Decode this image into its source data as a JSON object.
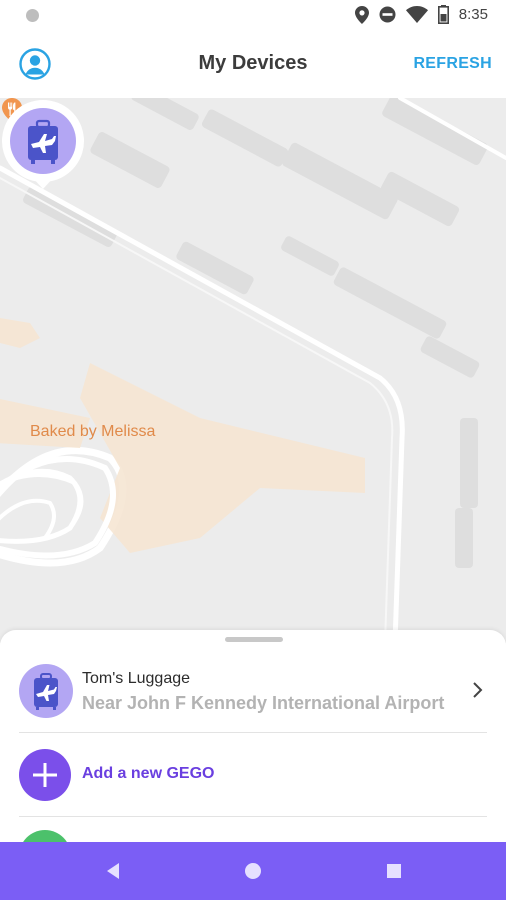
{
  "status_bar": {
    "time": "8:35",
    "icons": [
      "location-icon",
      "do-not-disturb-icon",
      "wifi-icon",
      "battery-icon"
    ]
  },
  "app_bar": {
    "title": "My Devices",
    "refresh_label": "REFRESH",
    "account_icon": "account-icon"
  },
  "map": {
    "poi_label": "Baked by Melissa",
    "poi_icon": "restaurant-icon",
    "marker_icon": "luggage-icon"
  },
  "devices": [
    {
      "name": "Tom's Luggage",
      "location": "Near John F Kennedy International Airport",
      "icon": "luggage-icon"
    }
  ],
  "add_device": {
    "label": "Add a new GEGO",
    "icon": "plus-icon"
  },
  "colors": {
    "accent_blue": "#2aa3e3",
    "purple": "#7b4fea",
    "nav_bar": "#7b5ef5",
    "avatar_bg": "#b3a6f3",
    "map_bg": "#ececec",
    "poi_text": "#e08a4a"
  },
  "nav_bar": [
    "back-icon",
    "home-icon",
    "recents-icon"
  ]
}
